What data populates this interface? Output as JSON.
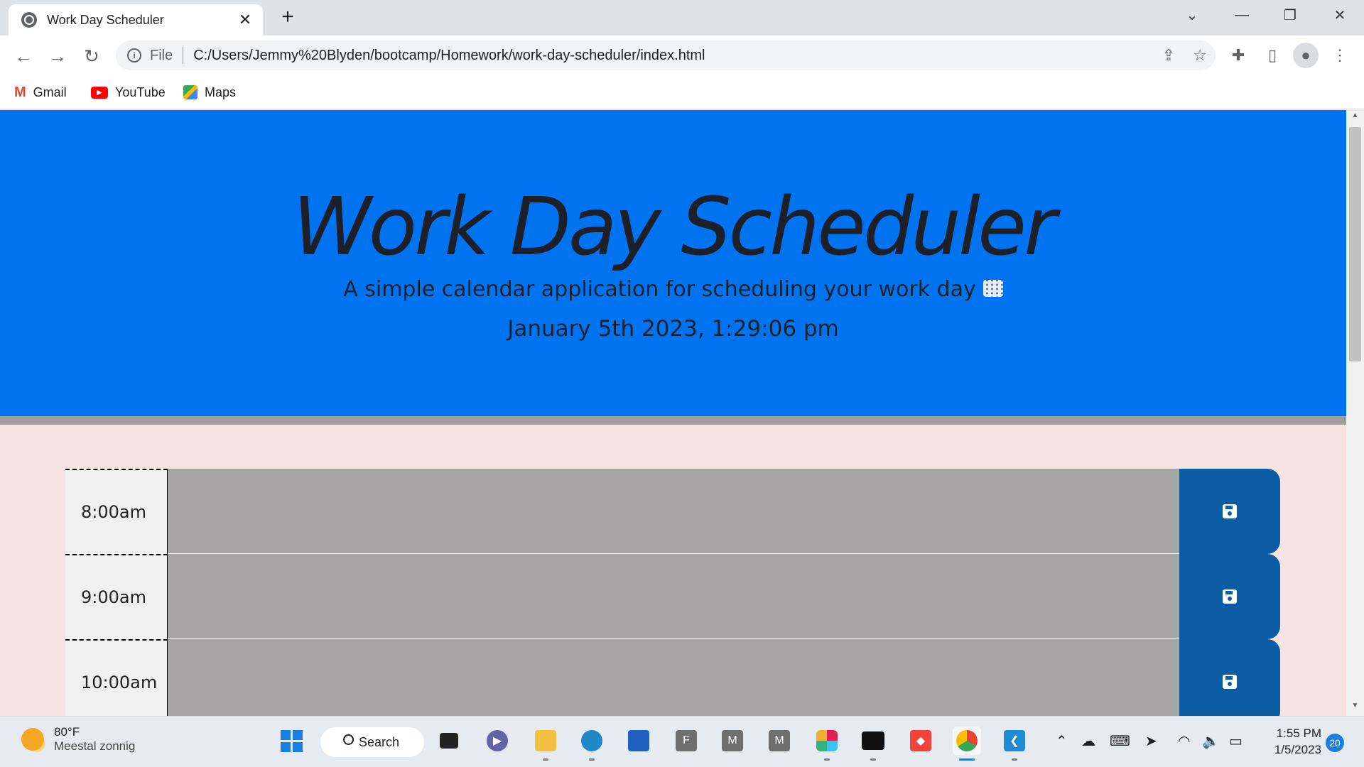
{
  "browser": {
    "tab_title": "Work Day Scheduler",
    "tab_close": "✕",
    "new_tab": "+",
    "address_scheme": "File",
    "address_url": "C:/Users/Jemmy%20Blyden/bootcamp/Homework/work-day-scheduler/index.html",
    "bookmarks": [
      {
        "label": "Gmail",
        "icon": "gmail-icon",
        "color": "#ea4335"
      },
      {
        "label": "YouTube",
        "icon": "youtube-icon",
        "color": "#ff0000"
      },
      {
        "label": "Maps",
        "icon": "maps-icon",
        "color": "#34a853"
      }
    ]
  },
  "page": {
    "title": "Work Day Scheduler",
    "lead": "A simple calendar application for scheduling your work day",
    "current_date": "January 5th 2023, 1:29:06 pm",
    "colors": {
      "header": "#0074f0",
      "background": "#f7e3e3",
      "past_block": "#a6a4a5",
      "save_button": "#0b5ca2"
    },
    "time_blocks": [
      {
        "hour": "8:00am",
        "text": ""
      },
      {
        "hour": "9:00am",
        "text": ""
      },
      {
        "hour": "10:00am",
        "text": ""
      }
    ]
  },
  "taskbar": {
    "weather_temp": "80°F",
    "weather_desc": "Meestal zonnig",
    "search_label": "Search",
    "clock_time": "1:55 PM",
    "clock_date": "1/5/2023",
    "notifications": "20"
  }
}
